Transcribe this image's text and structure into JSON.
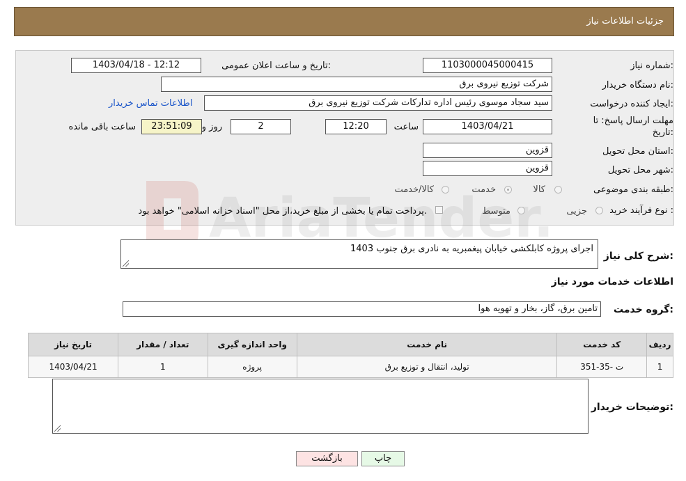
{
  "header": {
    "title": "جزئیات اطلاعات نیاز"
  },
  "fields": {
    "need_number_label": "شماره نیاز:",
    "need_number": "1103000045000415",
    "announce_label": "تاریخ و ساعت اعلان عمومی:",
    "announce_value": "1403/04/18 - 12:12",
    "buyer_org_label": "نام دستگاه خریدار:",
    "buyer_org": "شرکت توزیع نیروی برق",
    "creator_label": "ایجاد کننده درخواست:",
    "creator": "سید سجاد موسوی رئیس اداره تدارکات شرکت توزیع نیروی برق",
    "contact_link": "اطلاعات تماس خریدار",
    "deadline_label_1": "مهلت ارسال پاسخ: تا",
    "deadline_label_2": "تاریخ:",
    "deadline_date": "1403/04/21",
    "time_label": "ساعت",
    "deadline_time": "12:20",
    "days_value": "2",
    "days_label": "روز و",
    "remaining_time": "23:51:09",
    "remaining_label": "ساعت باقی مانده",
    "province_label": "استان محل تحویل:",
    "province": "قزوین",
    "city_label": "شهر محل تحویل:",
    "city": "قزوین",
    "category_label": "طبقه بندی موضوعی:",
    "category_options": [
      "کالا",
      "خدمت",
      "کالا/خدمت"
    ],
    "category_selected": "خدمت",
    "process_label": "نوع فرآیند خرید :",
    "process_options": [
      "جزیی",
      "متوسط"
    ],
    "payment_note": "پرداخت تمام یا بخشی از مبلغ خرید،از محل \"اسناد خزانه اسلامی\" خواهد بود."
  },
  "summary": {
    "label": "شرح کلی نیاز:",
    "text": "اجرای پروژه کابلکشی خیابان پیغمبریه به نادری برق جنوب 1403"
  },
  "services": {
    "section_title": "اطلاعات خدمات مورد نیاز",
    "group_label": "گروه خدمت:",
    "group_value": "تامین برق، گاز، بخار و تهویه هوا",
    "columns": [
      "ردیف",
      "کد خدمت",
      "نام خدمت",
      "واحد اندازه گیری",
      "تعداد / مقدار",
      "تاریخ نیاز"
    ],
    "rows": [
      [
        "1",
        "ت -35-351",
        "تولید، انتقال و توزیع برق",
        "پروژه",
        "1",
        "1403/04/21"
      ]
    ]
  },
  "buyer_notes": {
    "label": "توضیحات خریدار:",
    "text": ""
  },
  "buttons": {
    "print": "چاپ",
    "back": "بازگشت"
  },
  "watermark": {
    "text": "AriaTender.net"
  },
  "colors": {
    "header_bg": "#9a7a4e",
    "link": "#1a55c9",
    "back_button_bg": "#fde3e3",
    "print_button_bg": "#e6f9e6"
  }
}
